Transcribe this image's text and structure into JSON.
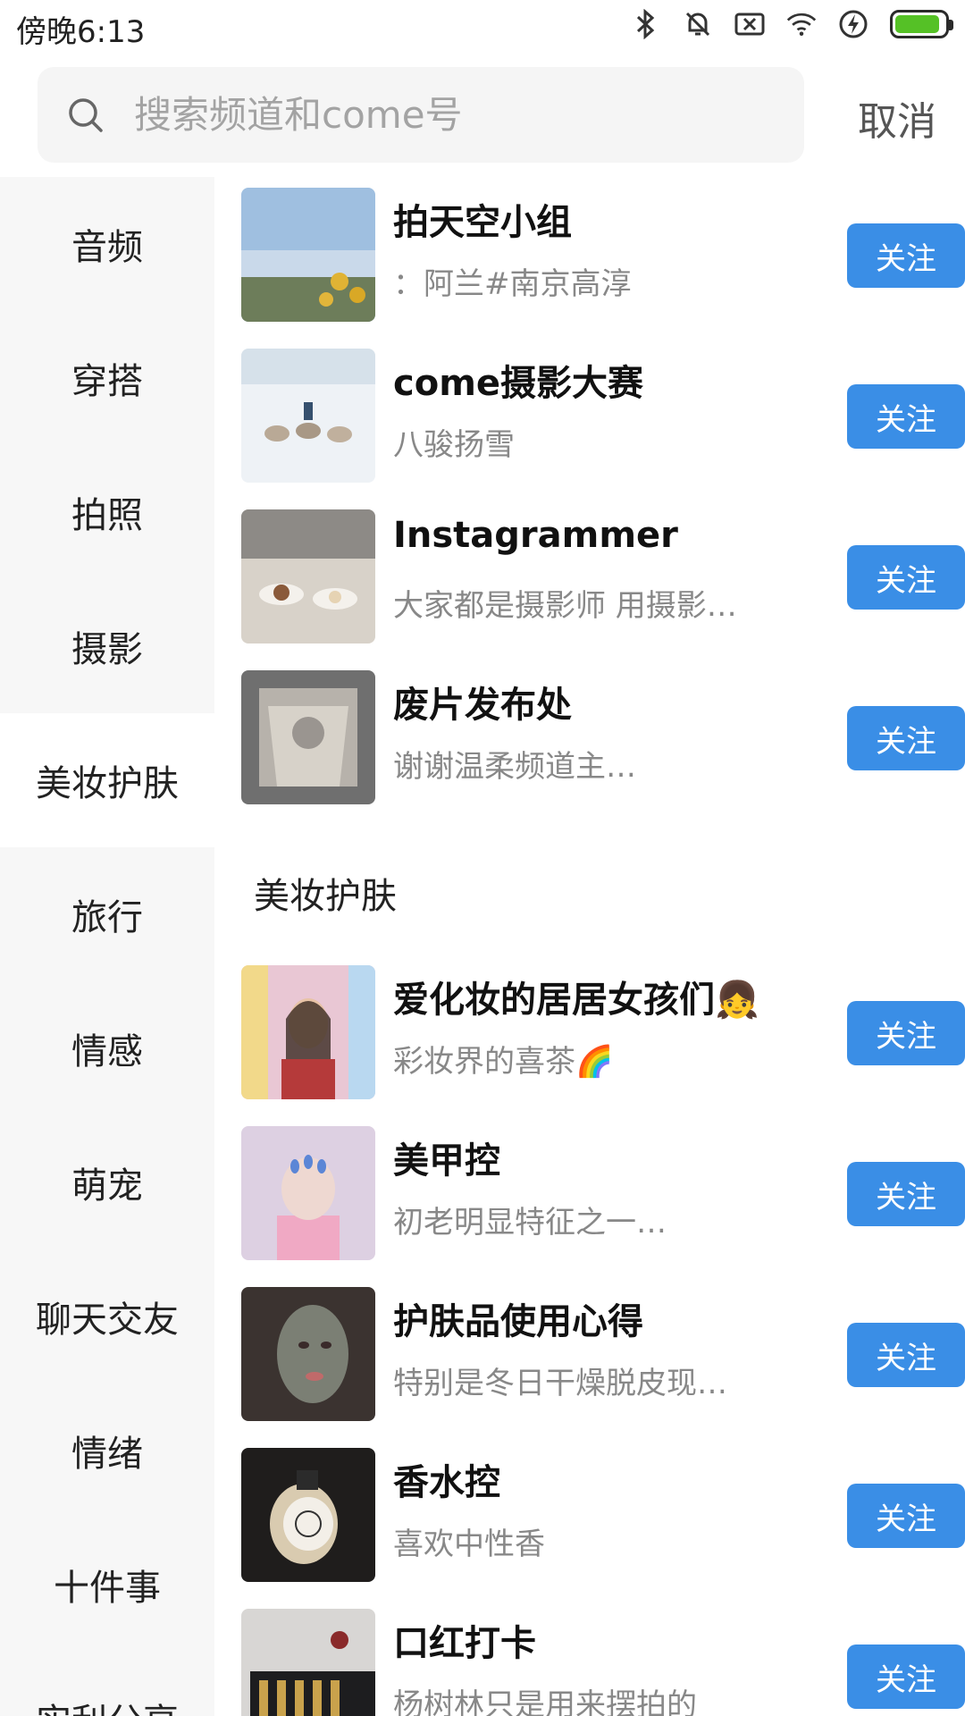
{
  "status": {
    "time": "傍晚6:13",
    "icons": [
      "bluetooth-icon",
      "alarm-off-icon",
      "sim-off-icon",
      "wifi-icon",
      "flash-icon",
      "battery-icon"
    ],
    "battery_level": 0.9
  },
  "search": {
    "placeholder": "搜索频道和come号",
    "cancel": "取消"
  },
  "sidebar": {
    "items": [
      {
        "label": "音频"
      },
      {
        "label": "穿搭"
      },
      {
        "label": "拍照"
      },
      {
        "label": "摄影"
      },
      {
        "label": "美妆护肤"
      },
      {
        "label": "旅行"
      },
      {
        "label": "情感"
      },
      {
        "label": "萌宠"
      },
      {
        "label": "聊天交友"
      },
      {
        "label": "情绪"
      },
      {
        "label": "十件事"
      },
      {
        "label": "实利分享"
      }
    ],
    "active": "美妆护肤"
  },
  "photography": {
    "items": [
      {
        "title": "拍天空小组",
        "desc": "：阿兰#南京高淳",
        "follow": "关注"
      },
      {
        "title": "come摄影大赛",
        "desc": "八骏扬雪",
        "follow": "关注"
      },
      {
        "title": "Instagrammer",
        "desc": "大家都是摄影师 用摄影…",
        "follow": "关注"
      },
      {
        "title": "废片发布处",
        "desc": "谢谢温柔频道主…",
        "follow": "关注"
      }
    ]
  },
  "beauty": {
    "title": "美妆护肤",
    "items": [
      {
        "title": "爱化妆的居居女孩们👧",
        "desc": "彩妆界的喜茶🌈",
        "follow": "关注"
      },
      {
        "title": "美甲控",
        "desc": "初老明显特征之一…",
        "follow": "关注"
      },
      {
        "title": "护肤品使用心得",
        "desc": "特别是冬日干燥脱皮现…",
        "follow": "关注"
      },
      {
        "title": "香水控",
        "desc": "喜欢中性香",
        "follow": "关注"
      },
      {
        "title": "口红打卡",
        "desc": "杨树林只是用来摆拍的",
        "follow": "关注"
      }
    ]
  },
  "colors": {
    "accent": "#3a8ee6",
    "sidebar_bg": "#f7f7f7",
    "battery": "#55c126"
  }
}
